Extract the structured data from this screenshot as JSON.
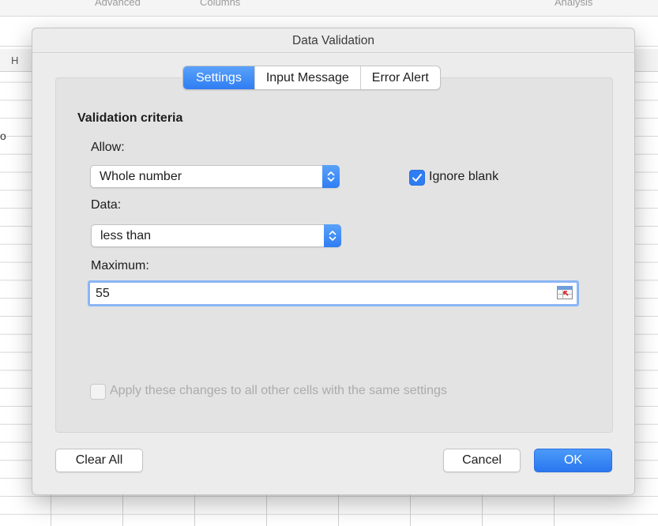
{
  "background": {
    "toolbar": {
      "left_item": "Advanced",
      "mid_item": "Columns",
      "right_item": "Analysis"
    },
    "column_header": "H",
    "side_text": "o"
  },
  "dialog": {
    "title": "Data Validation",
    "tabs": [
      {
        "label": "Settings",
        "active": true
      },
      {
        "label": "Input Message",
        "active": false
      },
      {
        "label": "Error Alert",
        "active": false
      }
    ],
    "section_heading": "Validation criteria",
    "allow": {
      "label": "Allow:",
      "value": "Whole number"
    },
    "ignore_blank": {
      "label": "Ignore blank",
      "checked": true
    },
    "data": {
      "label": "Data:",
      "value": "less than"
    },
    "maximum": {
      "label": "Maximum:",
      "value": "55"
    },
    "apply_all": {
      "label": "Apply these changes to all other cells with the same settings",
      "checked": false,
      "enabled": false
    },
    "buttons": {
      "clear_all": "Clear All",
      "cancel": "Cancel",
      "ok": "OK"
    }
  },
  "colors": {
    "accent": "#2f7df3",
    "dialog_bg": "#ececec",
    "panel_bg": "#e3e3e3"
  },
  "icons": {
    "stepper": "up-down-chevron-icon",
    "checkmark": "checkmark-icon",
    "range_picker": "range-picker-icon"
  }
}
